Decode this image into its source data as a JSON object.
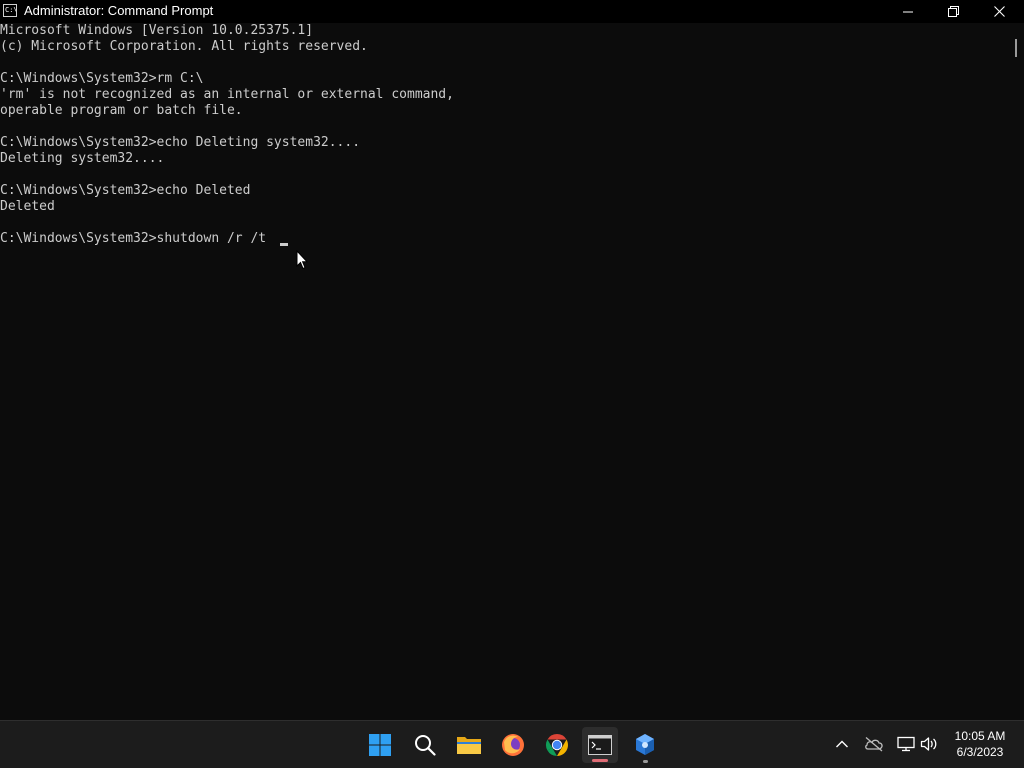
{
  "window": {
    "title": "Administrator: Command Prompt",
    "icon": "cmd-icon",
    "icon_text": "C:\\",
    "controls": [
      "minimize-icon",
      "maximize-icon",
      "close-icon"
    ]
  },
  "console": {
    "background": "#0c0c0c",
    "text_color": "#cccccc",
    "lines": [
      "Microsoft Windows [Version 10.0.25375.1]",
      "(c) Microsoft Corporation. All rights reserved.",
      "",
      "C:\\Windows\\System32>rm C:\\",
      "'rm' is not recognized as an internal or external command,",
      "operable program or batch file.",
      "",
      "C:\\Windows\\System32>echo Deleting system32....",
      "Deleting system32....",
      "",
      "C:\\Windows\\System32>echo Deleted",
      "Deleted",
      "",
      "C:\\Windows\\System32>shutdown /r /t "
    ]
  },
  "taskbar": {
    "apps": [
      "windows-start-icon",
      "search-icon",
      "file-explorer-icon",
      "firefox-icon",
      "chrome-icon",
      "command-prompt-icon",
      "app-icon"
    ],
    "active_app": "command-prompt-icon",
    "tray": [
      "chevron-up-icon",
      "onedrive-offline-icon",
      "network-icon",
      "volume-icon"
    ],
    "clock": {
      "time": "10:05 AM",
      "date": "6/3/2023"
    }
  }
}
